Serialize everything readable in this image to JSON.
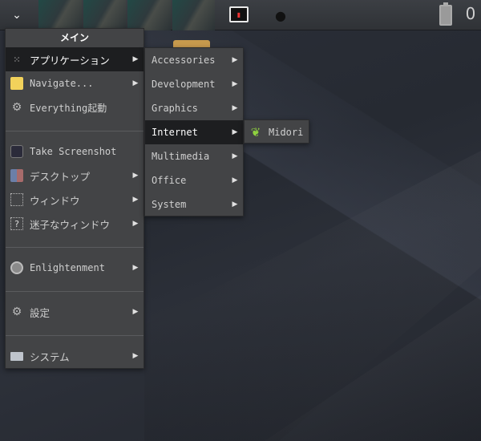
{
  "main_menu": {
    "title": "メイン",
    "items": [
      {
        "label": "アプリケーション",
        "icon": "apps-icon",
        "has_submenu": true,
        "selected": true
      },
      {
        "label": "Navigate...",
        "icon": "folder-icon",
        "has_submenu": true
      },
      {
        "label": "Everything起動",
        "icon": "gear-icon",
        "has_submenu": false
      },
      {
        "label": "Take Screenshot",
        "icon": "camera-icon",
        "has_submenu": false
      },
      {
        "label": "デスクトップ",
        "icon": "desktop-icon",
        "has_submenu": true
      },
      {
        "label": "ウィンドウ",
        "icon": "window-icon",
        "has_submenu": true
      },
      {
        "label": "迷子なウィンドウ",
        "icon": "lost-window-icon",
        "has_submenu": true
      },
      {
        "label": "Enlightenment",
        "icon": "enlightenment-icon",
        "has_submenu": true
      },
      {
        "label": "設定",
        "icon": "settings-gear-icon",
        "has_submenu": true
      },
      {
        "label": "システム",
        "icon": "monitor-icon",
        "has_submenu": true
      }
    ]
  },
  "applications_menu": {
    "items": [
      {
        "label": "Accessories"
      },
      {
        "label": "Development"
      },
      {
        "label": "Graphics"
      },
      {
        "label": "Internet",
        "selected": true
      },
      {
        "label": "Multimedia"
      },
      {
        "label": "Office"
      },
      {
        "label": "System"
      }
    ]
  },
  "internet_menu": {
    "items": [
      {
        "label": "Midori",
        "icon": "midori-leaf-icon"
      }
    ]
  },
  "shelf": {
    "clock_text": "0",
    "start_glyph": "⌄"
  },
  "colors": {
    "menu_bg": "#434446",
    "selected_bg": "#1d1e20",
    "desktop_bg": "#262a32",
    "shelf_bg": "#35383c"
  }
}
